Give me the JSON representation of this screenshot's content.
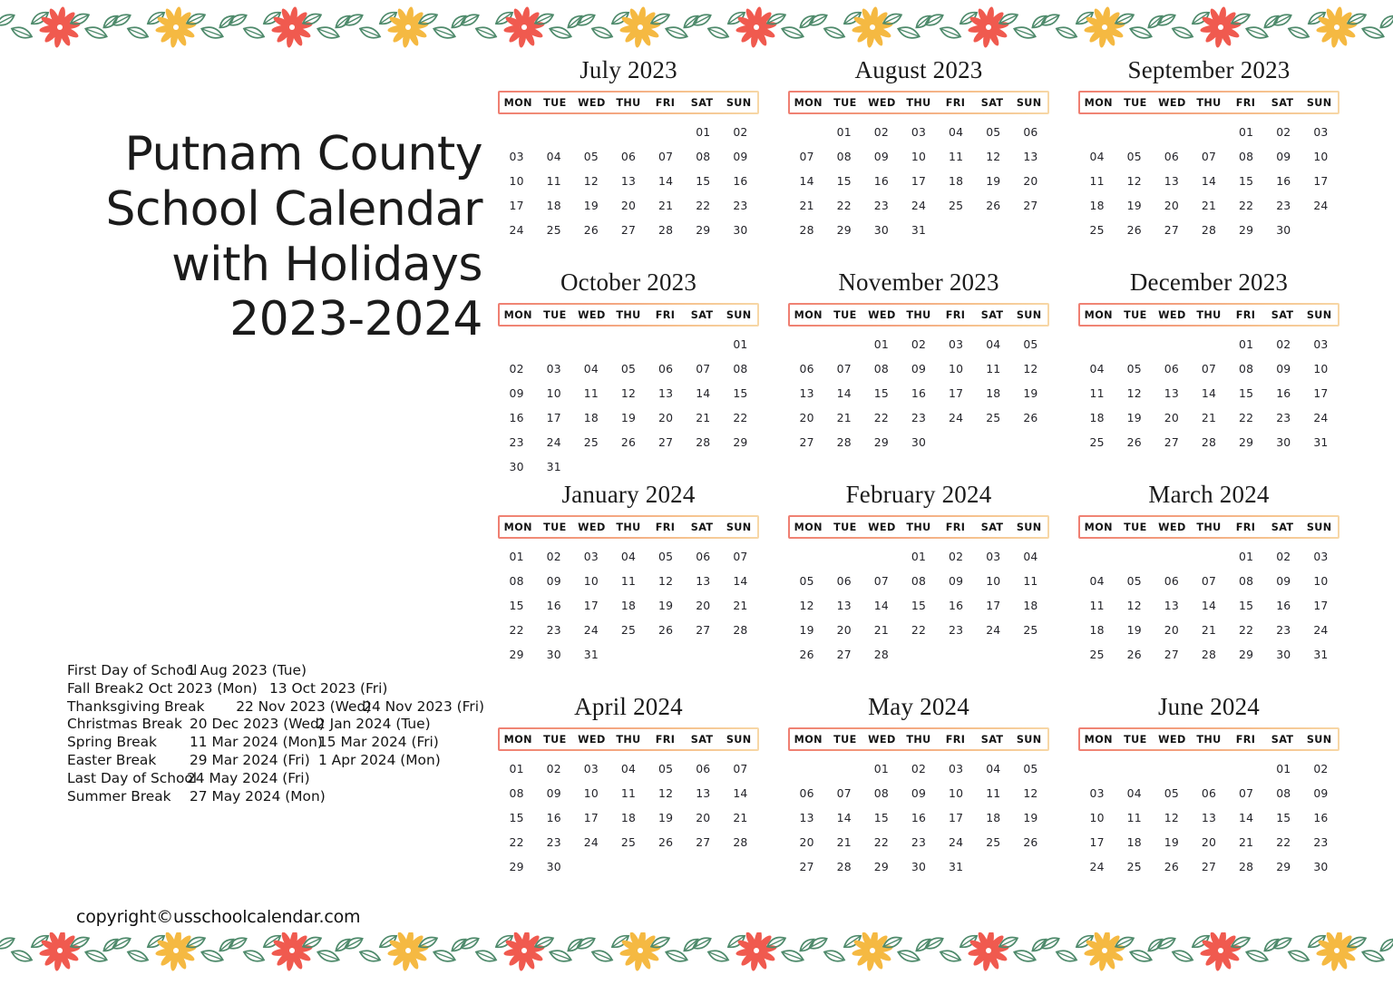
{
  "title": "Putnam County\nSchool Calendar\nwith Holidays\n2023-2024",
  "copyright": "copyright©usschoolcalendar.com",
  "colors": {
    "header_border_start": "#ef7f72",
    "header_border_end": "#f7d7a6",
    "flower_red": "#f05a4f",
    "flower_orange": "#f5b942",
    "leaf_green": "#4e8a6b",
    "text": "#1a1a1a"
  },
  "weekdays": [
    "MON",
    "TUE",
    "WED",
    "THU",
    "FRI",
    "SAT",
    "SUN"
  ],
  "holidays": [
    {
      "label": "First Day of School",
      "start": "1 Aug 2023 (Tue)",
      "end": ""
    },
    {
      "label": "Fall Break",
      "start": "2 Oct 2023 (Mon)",
      "end": "13 Oct 2023 (Fri)"
    },
    {
      "label": "Thanksgiving Break",
      "start": "22 Nov 2023 (Wed)",
      "end": "24 Nov 2023 (Fri)"
    },
    {
      "label": "Christmas Break",
      "start": "20 Dec 2023 (Wed)",
      "end": "2 Jan 2024 (Tue)"
    },
    {
      "label": "Spring Break",
      "start": "11 Mar 2024 (Mon)",
      "end": "15 Mar 2024 (Fri)"
    },
    {
      "label": "Easter Break",
      "start": "29 Mar 2024 (Fri)",
      "end": "1 Apr 2024 (Mon)"
    },
    {
      "label": "Last Day of School",
      "start": "24 May 2024 (Fri)",
      "end": ""
    },
    {
      "label": "Summer Break",
      "start": "27 May 2024 (Mon)",
      "end": ""
    }
  ],
  "months": [
    {
      "title": "July 2023",
      "lead": 5,
      "days": [
        "01",
        "02",
        "03",
        "04",
        "05",
        "06",
        "07",
        "08",
        "09",
        "10",
        "11",
        "12",
        "13",
        "14",
        "15",
        "16",
        "17",
        "18",
        "19",
        "20",
        "21",
        "22",
        "23",
        "24",
        "25",
        "26",
        "27",
        "28",
        "29",
        "30"
      ]
    },
    {
      "title": "August 2023",
      "lead": 1,
      "days": [
        "01",
        "02",
        "03",
        "04",
        "05",
        "06",
        "07",
        "08",
        "09",
        "10",
        "11",
        "12",
        "13",
        "14",
        "15",
        "16",
        "17",
        "18",
        "19",
        "20",
        "21",
        "22",
        "23",
        "24",
        "25",
        "26",
        "27",
        "28",
        "29",
        "30",
        "31"
      ]
    },
    {
      "title": "September 2023",
      "lead": 4,
      "days": [
        "01",
        "02",
        "03",
        "04",
        "05",
        "06",
        "07",
        "08",
        "09",
        "10",
        "11",
        "12",
        "13",
        "14",
        "15",
        "16",
        "17",
        "18",
        "19",
        "20",
        "21",
        "22",
        "23",
        "24",
        "25",
        "26",
        "27",
        "28",
        "29",
        "30"
      ]
    },
    {
      "title": "October 2023",
      "lead": 6,
      "days": [
        "01",
        "02",
        "03",
        "04",
        "05",
        "06",
        "07",
        "08",
        "09",
        "10",
        "11",
        "12",
        "13",
        "14",
        "15",
        "16",
        "17",
        "18",
        "19",
        "20",
        "21",
        "22",
        "23",
        "24",
        "25",
        "26",
        "27",
        "28",
        "29",
        "30",
        "31"
      ]
    },
    {
      "title": "November 2023",
      "lead": 2,
      "days": [
        "01",
        "02",
        "03",
        "04",
        "05",
        "06",
        "07",
        "08",
        "09",
        "10",
        "11",
        "12",
        "13",
        "14",
        "15",
        "16",
        "17",
        "18",
        "19",
        "20",
        "21",
        "22",
        "23",
        "24",
        "25",
        "26",
        "27",
        "28",
        "29",
        "30"
      ]
    },
    {
      "title": "December 2023",
      "lead": 4,
      "days": [
        "01",
        "02",
        "03",
        "04",
        "05",
        "06",
        "07",
        "08",
        "09",
        "10",
        "11",
        "12",
        "13",
        "14",
        "15",
        "16",
        "17",
        "18",
        "19",
        "20",
        "21",
        "22",
        "23",
        "24",
        "25",
        "26",
        "27",
        "28",
        "29",
        "30",
        "31"
      ]
    },
    {
      "title": "January 2024",
      "lead": 0,
      "days": [
        "01",
        "02",
        "03",
        "04",
        "05",
        "06",
        "07",
        "08",
        "09",
        "10",
        "11",
        "12",
        "13",
        "14",
        "15",
        "16",
        "17",
        "18",
        "19",
        "20",
        "21",
        "22",
        "23",
        "24",
        "25",
        "26",
        "27",
        "28",
        "29",
        "30",
        "31"
      ]
    },
    {
      "title": "February 2024",
      "lead": 3,
      "days": [
        "01",
        "02",
        "03",
        "04",
        "05",
        "06",
        "07",
        "08",
        "09",
        "10",
        "11",
        "12",
        "13",
        "14",
        "15",
        "16",
        "17",
        "18",
        "19",
        "20",
        "21",
        "22",
        "23",
        "24",
        "25",
        "26",
        "27",
        "28"
      ]
    },
    {
      "title": "March 2024",
      "lead": 4,
      "days": [
        "01",
        "02",
        "03",
        "04",
        "05",
        "06",
        "07",
        "08",
        "09",
        "10",
        "11",
        "12",
        "13",
        "14",
        "15",
        "16",
        "17",
        "18",
        "19",
        "20",
        "21",
        "22",
        "23",
        "24",
        "25",
        "26",
        "27",
        "28",
        "29",
        "30",
        "31"
      ]
    },
    {
      "title": "April 2024",
      "lead": 0,
      "days": [
        "01",
        "02",
        "03",
        "04",
        "05",
        "06",
        "07",
        "08",
        "09",
        "10",
        "11",
        "12",
        "13",
        "14",
        "15",
        "16",
        "17",
        "18",
        "19",
        "20",
        "21",
        "22",
        "23",
        "24",
        "25",
        "26",
        "27",
        "28",
        "29",
        "30"
      ]
    },
    {
      "title": "May 2024",
      "lead": 2,
      "days": [
        "01",
        "02",
        "03",
        "04",
        "05",
        "06",
        "07",
        "08",
        "09",
        "10",
        "11",
        "12",
        "13",
        "14",
        "15",
        "16",
        "17",
        "18",
        "19",
        "20",
        "21",
        "22",
        "23",
        "24",
        "25",
        "26",
        "27",
        "28",
        "29",
        "30",
        "31"
      ]
    },
    {
      "title": "June 2024",
      "lead": 5,
      "days": [
        "01",
        "02",
        "03",
        "04",
        "05",
        "06",
        "07",
        "08",
        "09",
        "10",
        "11",
        "12",
        "13",
        "14",
        "15",
        "16",
        "17",
        "18",
        "19",
        "20",
        "21",
        "22",
        "23",
        "24",
        "25",
        "26",
        "27",
        "28",
        "29",
        "30"
      ]
    }
  ],
  "decor": {
    "top_band": "floral-border-band",
    "bottom_band": "floral-border-band"
  }
}
